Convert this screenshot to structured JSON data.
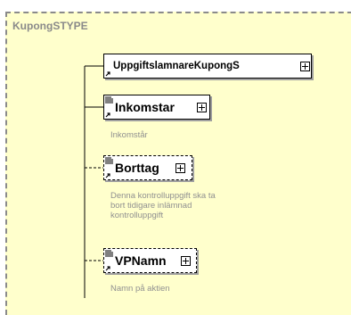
{
  "container": {
    "title": "KupongSTYPE"
  },
  "elements": [
    {
      "name": "UppgiftslamnareKupongS"
    },
    {
      "name": "Inkomstar",
      "description": "Inkomstår"
    },
    {
      "name": "Borttag",
      "description_lines": [
        "Denna kontrolluppgift ska ta",
        "bort tidigare inlämnad",
        "kontrolluppgift"
      ]
    },
    {
      "name": "VPNamn",
      "description": "Namn på aktien"
    }
  ]
}
